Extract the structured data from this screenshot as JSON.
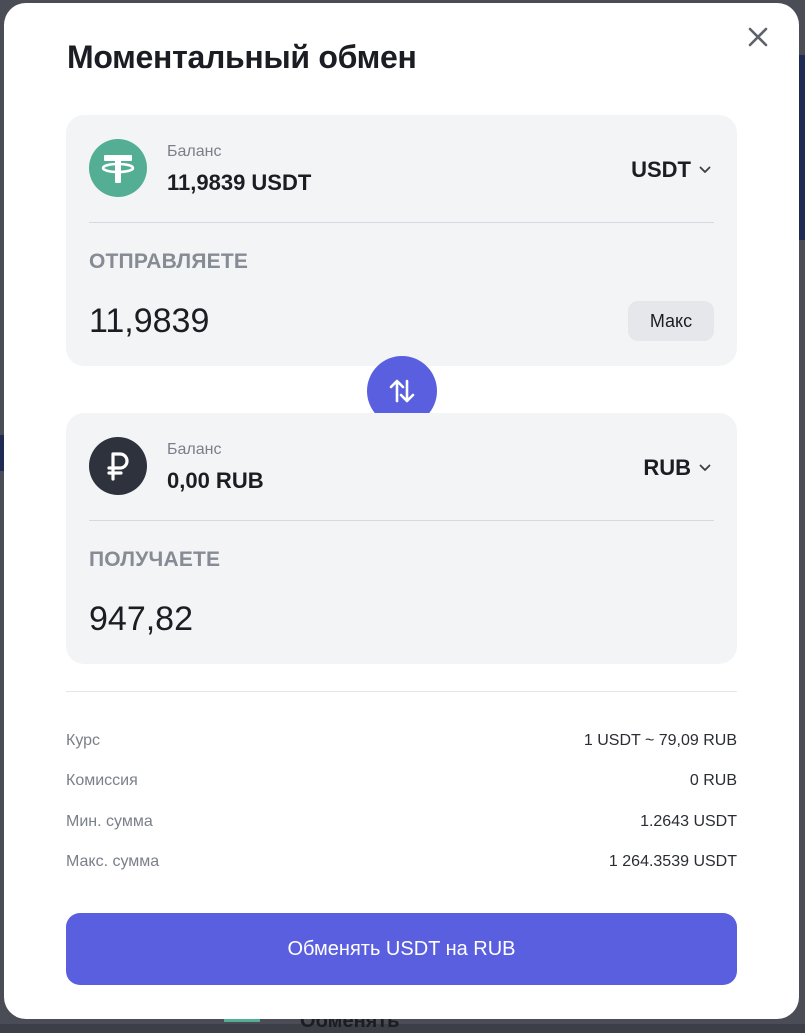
{
  "modal": {
    "title": "Моментальный обмен"
  },
  "send": {
    "coin_icon": "tether-icon",
    "balance_label": "Баланс",
    "balance_value": "11,9839 USDT",
    "currency": "USDT",
    "direction_label": "ОТПРАВЛЯЕТЕ",
    "amount": "11,9839",
    "max_label": "Макс"
  },
  "receive": {
    "coin_icon": "ruble-icon",
    "balance_label": "Баланс",
    "balance_value": "0,00 RUB",
    "currency": "RUB",
    "direction_label": "ПОЛУЧАЕТЕ",
    "amount": "947,82"
  },
  "info": {
    "rate_label": "Курс",
    "rate_value": "1 USDT ~ 79,09 RUB",
    "fee_label": "Комиссия",
    "fee_value": "0 RUB",
    "min_label": "Мин. сумма",
    "min_value": "1.2643 USDT",
    "max_label": "Макс. сумма",
    "max_value": "1 264.3539 USDT"
  },
  "submit_label": "Обменять USDT на RUB",
  "background_peek_text": "Обменять",
  "colors": {
    "accent": "#5a5fe0",
    "usdt": "#53ae94",
    "rub": "#2d323c"
  }
}
